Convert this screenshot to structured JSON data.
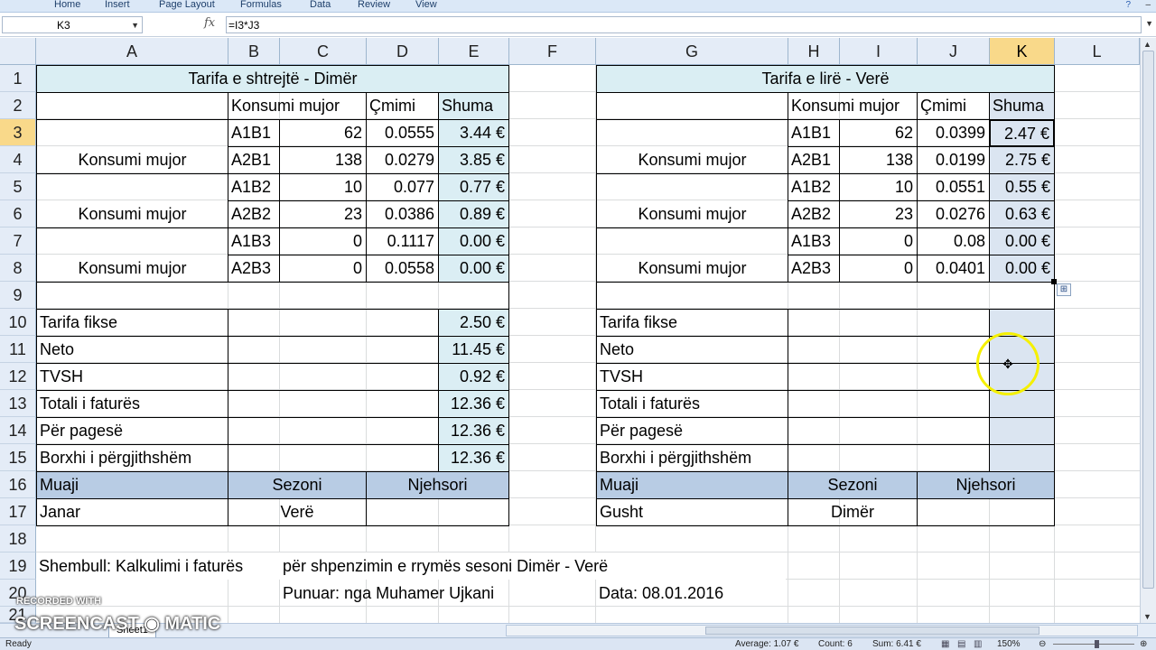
{
  "ribbon": {
    "tabs": [
      "Home",
      "Insert",
      "Page Layout",
      "Formulas",
      "Data",
      "Review",
      "View"
    ],
    "help": "?",
    "minimize": "–"
  },
  "formula_bar": {
    "name_box": "K3",
    "fx": "fx",
    "formula": "=I3*J3"
  },
  "columns": [
    "A",
    "B",
    "C",
    "D",
    "E",
    "F",
    "G",
    "H",
    "I",
    "J",
    "K",
    "L"
  ],
  "rows": [
    "1",
    "2",
    "3",
    "4",
    "5",
    "6",
    "7",
    "8",
    "9",
    "10",
    "11",
    "12",
    "13",
    "14",
    "15",
    "16",
    "17",
    "18",
    "19",
    "20",
    "21"
  ],
  "selected_cell": "K3",
  "left_table": {
    "title": "Tarifa e shtrejtë - Dimër",
    "head_konsumi": "Konsumi mujor",
    "head_cmimi": "Çmimi",
    "head_shuma": "Shuma",
    "group_labels": [
      "Konsumi mujor",
      "Konsumi mujor",
      "Konsumi mujor"
    ],
    "rows": [
      {
        "code": "A1B1",
        "kons": "62",
        "price": "0.0555",
        "sum": "3.44 €"
      },
      {
        "code": "A2B1",
        "kons": "138",
        "price": "0.0279",
        "sum": "3.85 €"
      },
      {
        "code": "A1B2",
        "kons": "10",
        "price": "0.077",
        "sum": "0.77 €"
      },
      {
        "code": "A2B2",
        "kons": "23",
        "price": "0.0386",
        "sum": "0.89 €"
      },
      {
        "code": "A1B3",
        "kons": "0",
        "price": "0.1117",
        "sum": "0.00 €"
      },
      {
        "code": "A2B3",
        "kons": "0",
        "price": "0.0558",
        "sum": "0.00 €"
      }
    ],
    "summary": [
      {
        "label": "Tarifa fikse",
        "value": "2.50 €"
      },
      {
        "label": "Neto",
        "value": "11.45 €"
      },
      {
        "label": "TVSH",
        "value": "0.92 €"
      },
      {
        "label": "Totali i faturës",
        "value": "12.36 €"
      },
      {
        "label": "Për pagesë",
        "value": "12.36 €"
      },
      {
        "label": "Borxhi i përgjithshëm",
        "value": "12.36 €"
      }
    ],
    "footer_headers": {
      "muaji": "Muaji",
      "sezoni": "Sezoni",
      "njehsori": "Njehsori"
    },
    "footer_values": {
      "muaji": "Janar",
      "sezoni": "Verë",
      "njehsori": ""
    }
  },
  "right_table": {
    "title": "Tarifa e lirë  - Verë",
    "head_konsumi": "Konsumi mujor",
    "head_cmimi": "Çmimi",
    "head_shuma": "Shuma",
    "group_labels": [
      "Konsumi mujor",
      "Konsumi mujor",
      "Konsumi mujor"
    ],
    "rows": [
      {
        "code": "A1B1",
        "kons": "62",
        "price": "0.0399",
        "sum": "2.47 €"
      },
      {
        "code": "A2B1",
        "kons": "138",
        "price": "0.0199",
        "sum": "2.75 €"
      },
      {
        "code": "A1B2",
        "kons": "10",
        "price": "0.0551",
        "sum": "0.55 €"
      },
      {
        "code": "A2B2",
        "kons": "23",
        "price": "0.0276",
        "sum": "0.63 €"
      },
      {
        "code": "A1B3",
        "kons": "0",
        "price": "0.08",
        "sum": "0.00 €"
      },
      {
        "code": "A2B3",
        "kons": "0",
        "price": "0.0401",
        "sum": "0.00 €"
      }
    ],
    "summary": [
      {
        "label": "Tarifa fikse",
        "value": ""
      },
      {
        "label": "Neto",
        "value": ""
      },
      {
        "label": "TVSH",
        "value": ""
      },
      {
        "label": "Totali i faturës",
        "value": ""
      },
      {
        "label": "Për pagesë",
        "value": ""
      },
      {
        "label": "Borxhi i përgjithshëm",
        "value": ""
      }
    ],
    "footer_headers": {
      "muaji": "Muaji",
      "sezoni": "Sezoni",
      "njehsori": "Njehsori"
    },
    "footer_values": {
      "muaji": "Gusht",
      "sezoni": "Dimër",
      "njehsori": ""
    }
  },
  "notes": {
    "example": "Shembull: Kalkulimi i  faturës",
    "example_rest": "për shpenzimin e rrymës sesoni Dimër - Verë",
    "author": "Punuar: nga Muhamer Ujkani",
    "date": "Data: 08.01.2016"
  },
  "status_bar": {
    "ready": "Ready",
    "average": "Average: 1.07 €",
    "count": "Count: 6",
    "sum": "Sum: 6.41 €",
    "zoom": "150%"
  },
  "watermark": {
    "recorded": "RECORDED WITH",
    "brand": "SCREENCAST ◉ MATIC"
  },
  "sheet_tab": "Sheet1"
}
